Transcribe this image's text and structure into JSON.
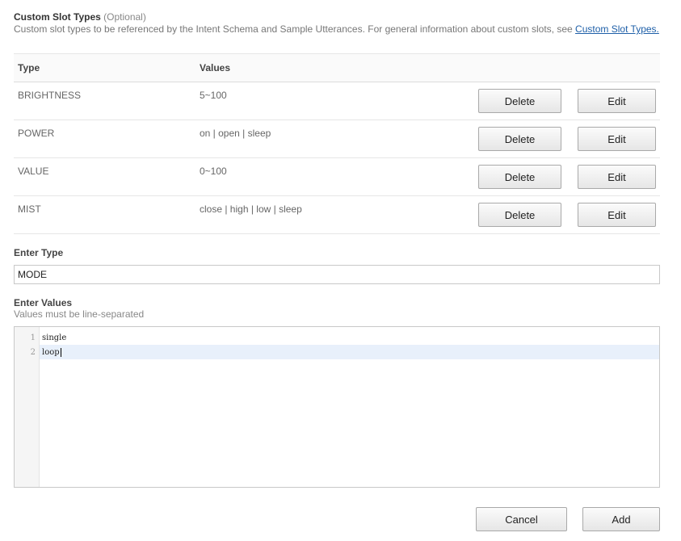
{
  "section": {
    "title": "Custom Slot Types",
    "optional": "(Optional)",
    "description": "Custom slot types to be referenced by the Intent Schema and Sample Utterances. For general information about custom slots, see",
    "link_text": "Custom Slot Types."
  },
  "table": {
    "headers": {
      "type": "Type",
      "values": "Values"
    },
    "rows": [
      {
        "type": "BRIGHTNESS",
        "values": "5~100",
        "delete_label": "Delete",
        "edit_label": "Edit"
      },
      {
        "type": "POWER",
        "values": "on | open | sleep",
        "delete_label": "Delete",
        "edit_label": "Edit"
      },
      {
        "type": "VALUE",
        "values": "0~100",
        "delete_label": "Delete",
        "edit_label": "Edit"
      },
      {
        "type": "MIST",
        "values": "close | high | low | sleep",
        "delete_label": "Delete",
        "edit_label": "Edit"
      }
    ]
  },
  "enter_type": {
    "label": "Enter Type",
    "value": "MODE"
  },
  "enter_values": {
    "label": "Enter Values",
    "hint": "Values must be line-separated",
    "lines": [
      {
        "number": "1",
        "text": "single"
      },
      {
        "number": "2",
        "text": "loop"
      }
    ]
  },
  "footer": {
    "cancel_label": "Cancel",
    "add_label": "Add"
  }
}
